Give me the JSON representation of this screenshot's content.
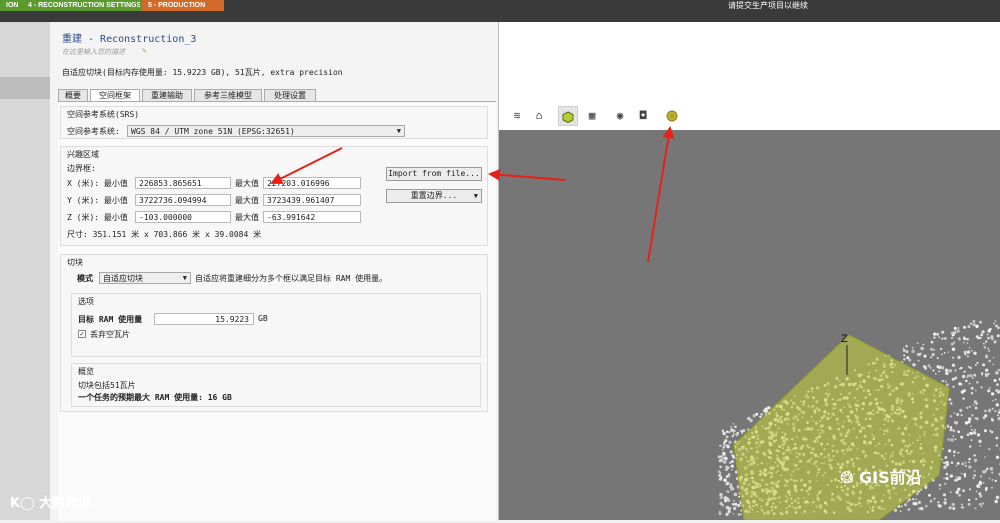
{
  "steps": [
    {
      "label": "ION"
    },
    {
      "label": "4 - RECONSTRUCTION SETTINGS"
    },
    {
      "label": "5 - PRODUCTION"
    }
  ],
  "top_hint": "请提交生产项目以继续",
  "reconstruction": {
    "title": "重建 - Reconstruction_3",
    "description_placeholder": "在这里输入您的描述",
    "mode_line": "自适应切块(目标内存使用量: 15.9223 GB), 51瓦片, extra precision"
  },
  "tabs": [
    {
      "label": "概要"
    },
    {
      "label": "空间框架"
    },
    {
      "label": "重建输助"
    },
    {
      "label": "参考三维模型"
    },
    {
      "label": "处理设置"
    }
  ],
  "srs": {
    "group_label": "空间参考系统(SRS)",
    "field_label": "空间参考系统:",
    "value": "WGS 84 / UTM zone 51N (EPSG:32651)"
  },
  "roi": {
    "group_label": "兴趣区域",
    "bbox_label": "边界框:",
    "rows": [
      {
        "axis": "X (米): 最小值",
        "min": "226853.865651",
        "max_label": "最大值",
        "max": "227203.016996"
      },
      {
        "axis": "Y (米): 最小值",
        "min": "3722736.094994",
        "max_label": "最大值",
        "max": "3723439.961407"
      },
      {
        "axis": "Z (米): 最小值",
        "min": "-103.000000",
        "max_label": "最大值",
        "max": "-63.991642"
      }
    ],
    "size_text": "尺寸: 351.151 米 x 703.866 米 x 39.0084 米",
    "import_button": "Import from file...",
    "reset_button": "重置边界..."
  },
  "tiling": {
    "group_label": "切块",
    "mode_label": "模式",
    "mode_value": "自适应切块",
    "mode_desc": "自适应将重建细分为多个框以满足目标 RAM 使用量。",
    "options_label": "选项",
    "target_ram_label": "目标 RAM 使用量",
    "target_ram_value": "15.9223",
    "target_ram_unit": "GB",
    "discard_empty_label": "丢弃空瓦片",
    "discard_empty_checked": true,
    "overview_label": "概览",
    "overview_line1": "切块包括51瓦片",
    "overview_line2": "一个任务的预期最大 RAM 使用量: 16 GB"
  },
  "toolbar_icons": [
    "layers-icon",
    "home-icon",
    "box-icon",
    "grid-icon",
    "eye-icon",
    "camera-icon",
    "tile-icon"
  ],
  "viewport": {
    "axis_label": "Z"
  },
  "watermarks": {
    "bottom_left": "大数跨境",
    "bottom_right": "GIS前沿"
  },
  "colors": {
    "step_done": "#5a9a2e",
    "step_current": "#d26a2a",
    "bbox_fill": "#c8d23a",
    "arrow": "#e8201a",
    "title": "#2a4a88"
  }
}
